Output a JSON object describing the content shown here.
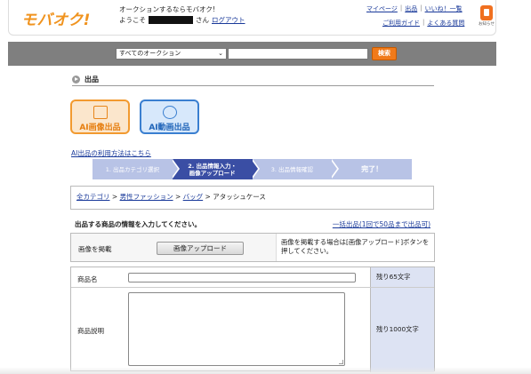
{
  "header": {
    "logo": "モバオク!",
    "tagline": "オークションするならモバオク!",
    "welcome_prefix": "ようこそ",
    "welcome_suffix": "さん",
    "logout": "ログアウト",
    "links_top": [
      "マイページ",
      "出品",
      "いいね！一覧"
    ],
    "links_bottom": [
      "ご利用ガイド",
      "よくある質問"
    ],
    "notify_label": "お知らせ"
  },
  "search": {
    "category_selected": "すべてのオークション",
    "query": "",
    "button": "検索"
  },
  "section": {
    "title": "出品"
  },
  "ai": {
    "image_button": "AI画像出品",
    "video_button": "AI動画出品",
    "howto_link": "AI出品の利用方法はこちら"
  },
  "steps": [
    {
      "line1": "1. 出品カテゴリ選択",
      "line2": ""
    },
    {
      "line1": "2. 出品情報入力・",
      "line2": "画像アップロード"
    },
    {
      "line1": "3. 出品情報確認",
      "line2": ""
    },
    {
      "line1": "完了！",
      "line2": ""
    }
  ],
  "breadcrumb": {
    "items": [
      "全カテゴリ",
      "男性ファッション",
      "バッグ"
    ],
    "current": "アタッシュケース",
    "sep": ">"
  },
  "form": {
    "intro": "出品する商品の情報を入力してください。",
    "bulk_link": "一括出品(1回で50品まで出品可)",
    "image_label": "画像を掲載",
    "upload_button": "画像アップロード",
    "image_hint": "画像を掲載する場合は[画像アップロード]ボタンを押してください。",
    "name_label": "商品名",
    "name_value": "",
    "name_remaining": "残り65文字",
    "desc_label": "商品説明",
    "desc_value": "",
    "desc_remaining": "残り1000文字"
  }
}
